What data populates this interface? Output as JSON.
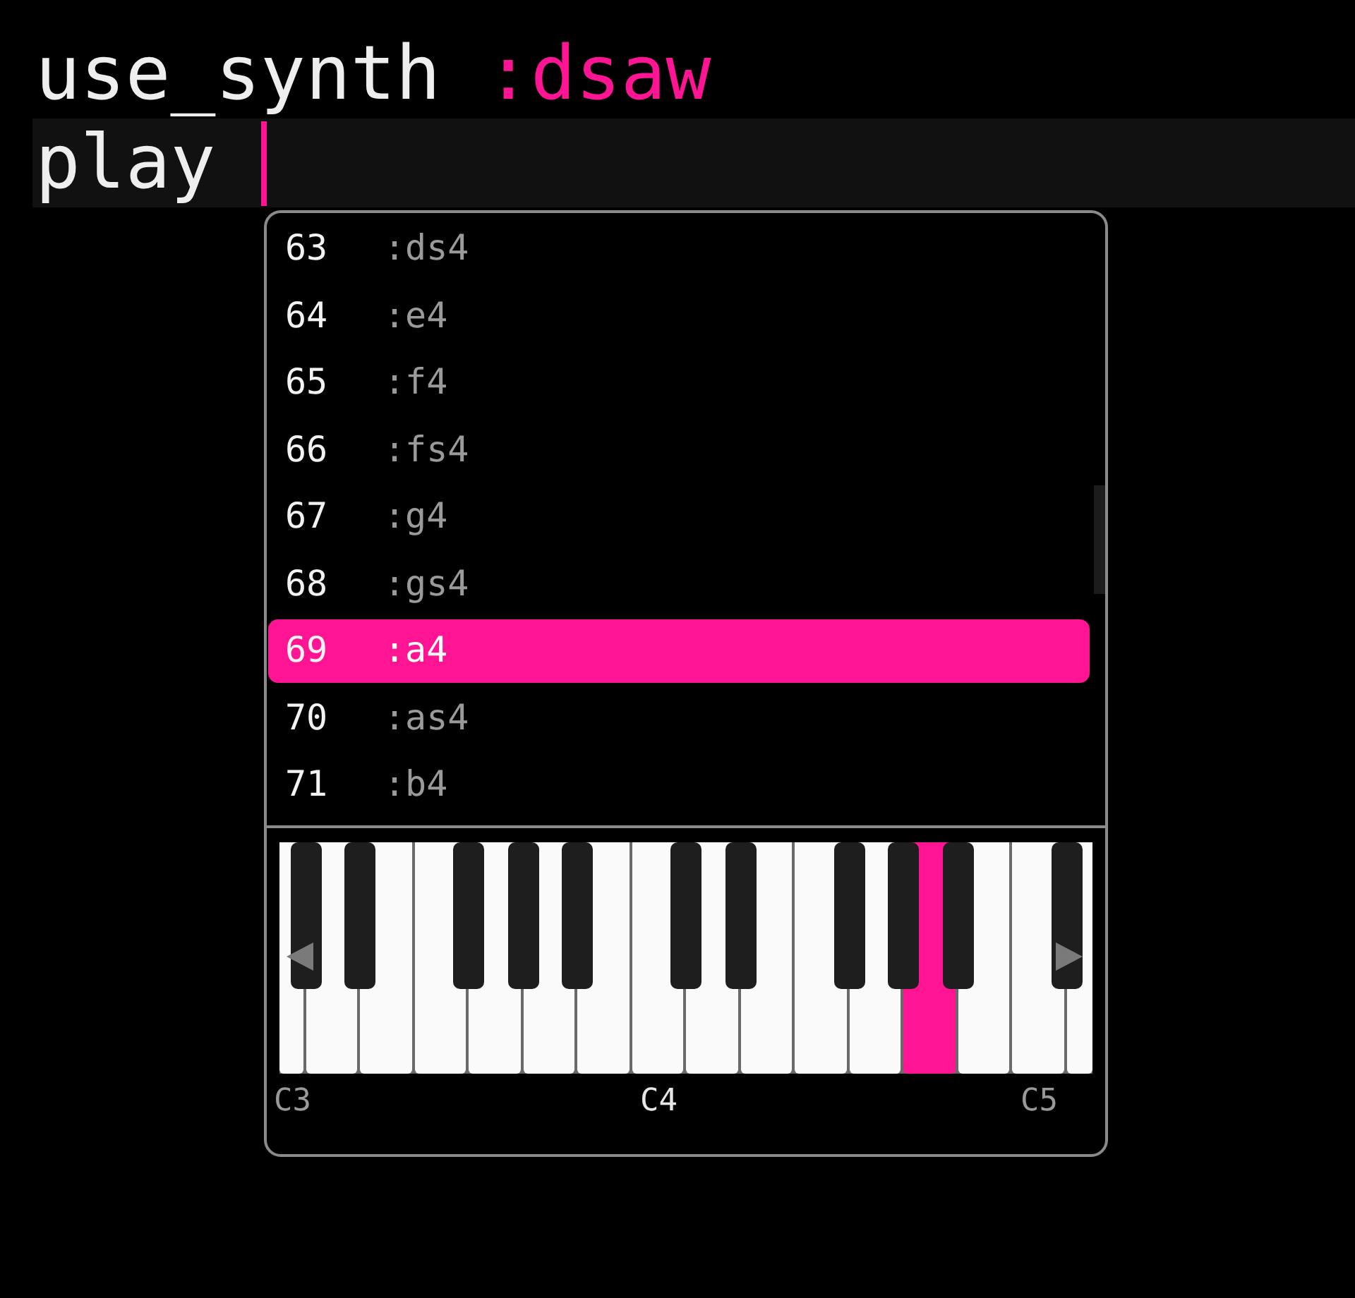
{
  "editor": {
    "lines": [
      {
        "current": false,
        "cursor": false,
        "tokens": [
          {
            "kind": "code",
            "text": "use_synth"
          },
          {
            "kind": "symbol",
            "text": ":dsaw"
          }
        ]
      },
      {
        "current": true,
        "cursor": true,
        "tokens": [
          {
            "kind": "code",
            "text": "play"
          }
        ]
      }
    ]
  },
  "autocomplete": {
    "items": [
      {
        "number": "63",
        "name": ":ds4",
        "selected": false
      },
      {
        "number": "64",
        "name": ":e4",
        "selected": false
      },
      {
        "number": "65",
        "name": ":f4",
        "selected": false
      },
      {
        "number": "66",
        "name": ":fs4",
        "selected": false
      },
      {
        "number": "67",
        "name": ":g4",
        "selected": false
      },
      {
        "number": "68",
        "name": ":gs4",
        "selected": false
      },
      {
        "number": "69",
        "name": ":a4",
        "selected": true
      },
      {
        "number": "70",
        "name": ":as4",
        "selected": false
      },
      {
        "number": "71",
        "name": ":b4",
        "selected": false
      }
    ]
  },
  "keyboard": {
    "keys": [
      {
        "kind": "natural",
        "pressed": false,
        "label": {
          "text": "C3",
          "highlighted": false
        }
      },
      {
        "kind": "sharp",
        "pressed": false
      },
      {
        "kind": "natural",
        "pressed": false
      },
      {
        "kind": "sharp",
        "pressed": false
      },
      {
        "kind": "natural",
        "pressed": false
      },
      {
        "kind": "natural",
        "pressed": false
      },
      {
        "kind": "sharp",
        "pressed": false
      },
      {
        "kind": "natural",
        "pressed": false
      },
      {
        "kind": "sharp",
        "pressed": false
      },
      {
        "kind": "natural",
        "pressed": false
      },
      {
        "kind": "sharp",
        "pressed": false
      },
      {
        "kind": "natural",
        "pressed": false
      },
      {
        "kind": "natural",
        "pressed": false,
        "label": {
          "text": "C4",
          "highlighted": true
        }
      },
      {
        "kind": "sharp",
        "pressed": false
      },
      {
        "kind": "natural",
        "pressed": false
      },
      {
        "kind": "sharp",
        "pressed": false
      },
      {
        "kind": "natural",
        "pressed": false
      },
      {
        "kind": "natural",
        "pressed": false
      },
      {
        "kind": "sharp",
        "pressed": false
      },
      {
        "kind": "natural",
        "pressed": false
      },
      {
        "kind": "sharp",
        "pressed": false
      },
      {
        "kind": "natural",
        "pressed": true
      },
      {
        "kind": "sharp",
        "pressed": false
      },
      {
        "kind": "natural",
        "pressed": false
      },
      {
        "kind": "natural",
        "pressed": false,
        "label": {
          "text": "C5",
          "highlighted": false
        }
      },
      {
        "kind": "sharp",
        "pressed": false
      },
      {
        "kind": "natural",
        "pressed": false
      }
    ]
  }
}
